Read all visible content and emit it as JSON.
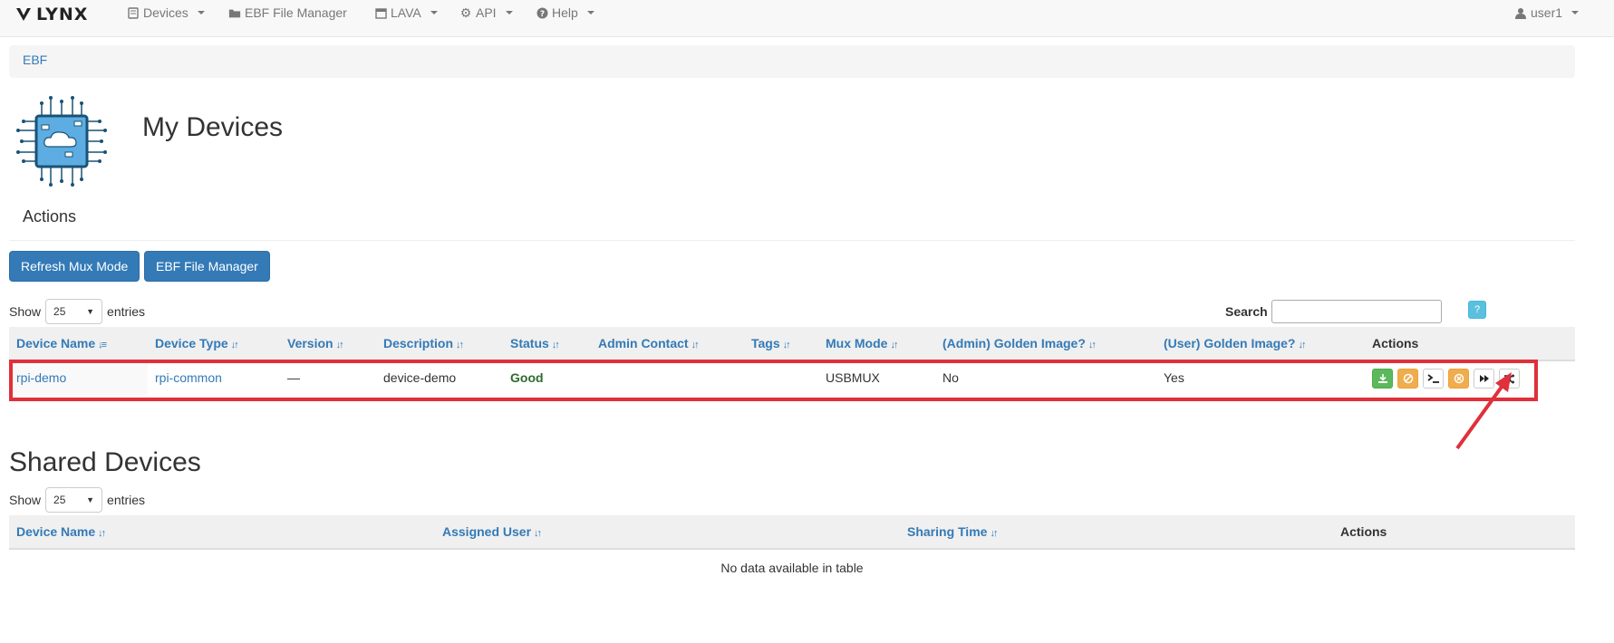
{
  "navbar": {
    "brand": "LYNX",
    "items": [
      {
        "label": "Devices",
        "icon": "device-icon",
        "dropdown": true
      },
      {
        "label": "EBF File Manager",
        "icon": "folder-icon",
        "dropdown": false
      },
      {
        "label": "LAVA",
        "icon": "calendar-icon",
        "dropdown": true
      },
      {
        "label": "API",
        "icon": "gear-icon",
        "dropdown": true
      },
      {
        "label": "Help",
        "icon": "question-icon",
        "dropdown": true
      }
    ],
    "user": "user1"
  },
  "breadcrumb": {
    "items": [
      "EBF"
    ]
  },
  "page": {
    "title": "My Devices",
    "actions_title": "Actions"
  },
  "buttons": {
    "refresh_mux": "Refresh Mux Mode",
    "ebf_file_manager": "EBF File Manager"
  },
  "my_devices": {
    "show_label": "Show",
    "entries_label": "entries",
    "page_length": "25",
    "search_label": "Search",
    "search_value": "",
    "help_label": "?",
    "columns": [
      "Device Name",
      "Device Type",
      "Version",
      "Description",
      "Status",
      "Admin Contact",
      "Tags",
      "Mux Mode",
      "(Admin) Golden Image?",
      "(User) Golden Image?",
      "Actions"
    ],
    "rows": [
      {
        "device_name": "rpi-demo",
        "device_type": "rpi-common",
        "version": "—",
        "description": "device-demo",
        "status": "Good",
        "admin_contact": "",
        "tags": "",
        "mux_mode": "USBMUX",
        "admin_golden": "No",
        "user_golden": "Yes",
        "actions": [
          {
            "icon": "download-icon",
            "color": "#5cb85c"
          },
          {
            "icon": "ban-icon",
            "color": "#f0ad4e"
          },
          {
            "icon": "terminal-icon",
            "color": "#ffffff"
          },
          {
            "icon": "close-circle-icon",
            "color": "#f0ad4e"
          },
          {
            "icon": "fast-forward-icon",
            "color": "#ffffff"
          },
          {
            "icon": "shuffle-icon",
            "color": "#ffffff"
          }
        ]
      }
    ]
  },
  "shared_devices": {
    "title": "Shared Devices",
    "show_label": "Show",
    "entries_label": "entries",
    "page_length": "25",
    "columns": [
      "Device Name",
      "Assigned User",
      "Sharing Time",
      "Actions"
    ],
    "empty_message": "No data available in table"
  },
  "colors": {
    "accent": "#337ab7",
    "highlight": "#e0303a",
    "status_good": "#2e6b2e"
  }
}
